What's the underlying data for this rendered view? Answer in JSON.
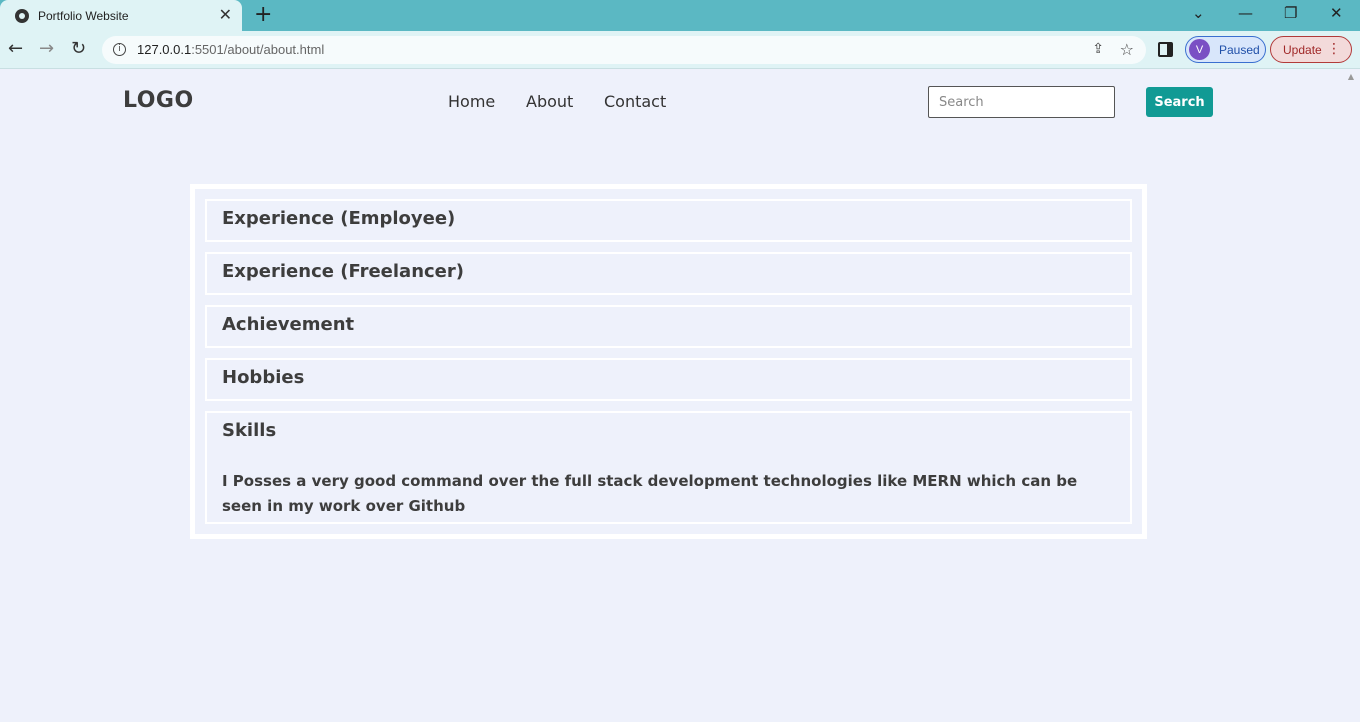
{
  "browser": {
    "tab_title": "Portfolio Website",
    "url_host": "127.0.0.1",
    "url_rest": ":5501/about/about.html",
    "profile_initial": "V",
    "profile_status": "Paused",
    "update_label": "Update"
  },
  "site": {
    "logo": "LOGO",
    "nav": [
      "Home",
      "About",
      "Contact"
    ],
    "search_placeholder": "Search",
    "search_button": "Search"
  },
  "accordion": {
    "items": [
      {
        "heading": "Experience (Employee)"
      },
      {
        "heading": "Experience (Freelancer)"
      },
      {
        "heading": "Achievement"
      },
      {
        "heading": "Hobbies"
      },
      {
        "heading": "Skills",
        "body": "I Posses a very good command over the full stack development technologies like MERN which can be seen in my work over Github"
      }
    ]
  },
  "colors": {
    "page_background": "#eef1fb",
    "tab_strip": "#5bb8c3",
    "search_button": "#119a94",
    "text": "#3d3d3d"
  }
}
